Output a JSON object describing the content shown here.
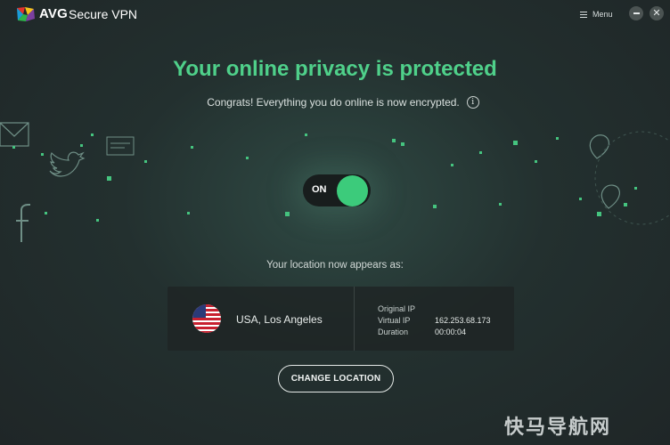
{
  "app": {
    "brand": "AVG",
    "product": "Secure VPN",
    "menu_label": "Menu"
  },
  "status": {
    "headline": "Your online privacy is protected",
    "subtext": "Congrats! Everything you do online is now encrypted.",
    "info_icon": "i",
    "toggle_label": "ON",
    "toggle_on": true
  },
  "location": {
    "title": "Your location now appears as:",
    "city": "USA, Los Angeles",
    "original_ip_label": "Original IP",
    "original_ip_value": "",
    "virtual_ip_label": "Virtual IP",
    "virtual_ip_value": "162.253.68.173",
    "duration_label": "Duration",
    "duration_value": "00:00:04",
    "change_button": "CHANGE LOCATION"
  },
  "icons": [
    "avg-logo-icon",
    "menu-icon",
    "minimize-icon",
    "close-icon",
    "info-icon",
    "us-flag-icon",
    "mail-icon",
    "card-icon",
    "twitter-icon",
    "facebook-icon",
    "location-pin-icon"
  ],
  "colors": {
    "accent": "#4fd08a",
    "toggle_knob": "#3ccb7b",
    "background": "#23302f"
  },
  "watermark": "快马导航网"
}
